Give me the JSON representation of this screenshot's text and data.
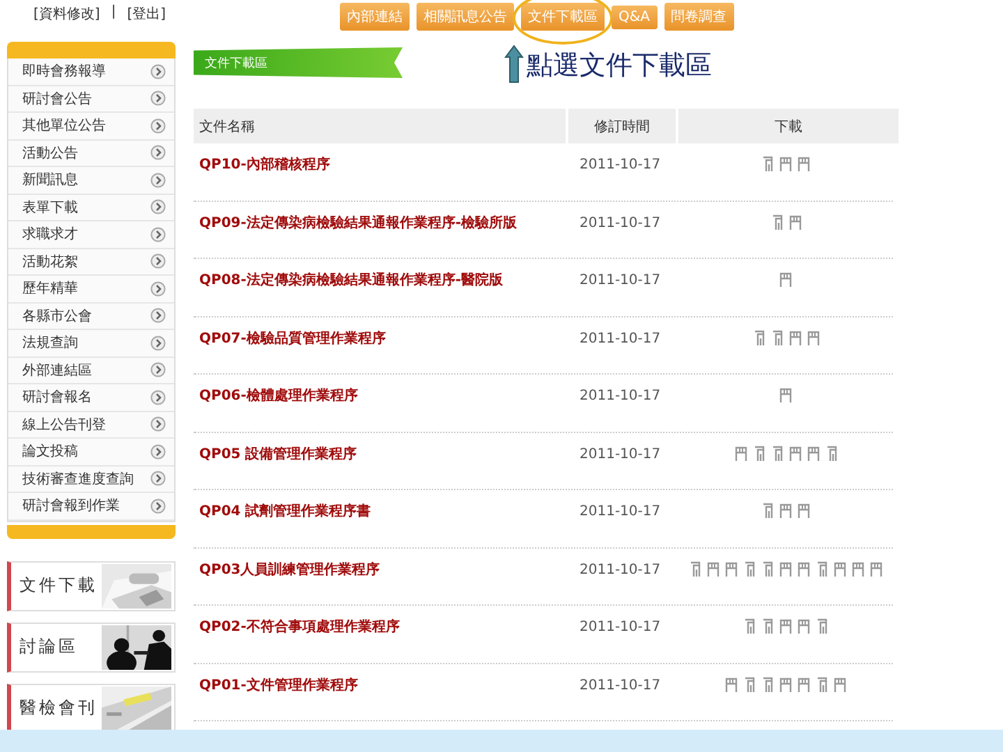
{
  "top_links": [
    "[資料修改]",
    "|",
    "[登出]"
  ],
  "nav": [
    {
      "label": "內部連結",
      "highlighted": false
    },
    {
      "label": "相關訊息公告",
      "highlighted": false
    },
    {
      "label": "文件下載區",
      "highlighted": true
    },
    {
      "label": "Q&A",
      "highlighted": false
    },
    {
      "label": "問卷調查",
      "highlighted": false
    }
  ],
  "annotation": "點選文件下載區",
  "banner": "文件下載區",
  "sidebar": {
    "items": [
      "即時會務報導",
      "研討會公告",
      "其他單位公告",
      "活動公告",
      "新聞訊息",
      "表單下載",
      "求職求才",
      "活動花絮",
      "歷年精華",
      "各縣市公會",
      "法規查詢",
      "外部連結區",
      "研討會報名",
      "線上公告刊登",
      "論文投稿",
      "技術審查進度查詢",
      "研討會報到作業"
    ]
  },
  "cards": [
    {
      "label": "文件下載",
      "kind": "picture"
    },
    {
      "label": "討論區",
      "kind": "picture"
    },
    {
      "label": "醫檢會刊",
      "kind": "picture"
    }
  ],
  "table": {
    "columns": [
      "文件名稱",
      "修訂時間",
      "下載"
    ],
    "rows": [
      {
        "name": "QP10-內部稽核程序",
        "date": "2011-10-17",
        "files": [
          {
            "kind": "doc"
          },
          {
            "kind": "form"
          },
          {
            "kind": "form"
          }
        ]
      },
      {
        "name": "QP09-法定傳染病檢驗結果通報作業程序-檢驗所版",
        "date": "2011-10-17",
        "files": [
          {
            "kind": "doc"
          },
          {
            "kind": "form"
          }
        ]
      },
      {
        "name": "QP08-法定傳染病檢驗結果通報作業程序-醫院版",
        "date": "2011-10-17",
        "files": [
          {
            "kind": "form"
          }
        ]
      },
      {
        "name": "QP07-檢驗品質管理作業程序",
        "date": "2011-10-17",
        "files": [
          {
            "kind": "doc"
          },
          {
            "kind": "doc"
          },
          {
            "kind": "form"
          },
          {
            "kind": "form"
          }
        ]
      },
      {
        "name": "QP06-檢體處理作業程序",
        "date": "2011-10-17",
        "files": [
          {
            "kind": "form"
          }
        ]
      },
      {
        "name": "QP05 設備管理作業程序",
        "date": "2011-10-17",
        "files": [
          {
            "kind": "form"
          },
          {
            "kind": "doc"
          },
          {
            "kind": "doc"
          },
          {
            "kind": "form"
          },
          {
            "kind": "form"
          },
          {
            "kind": "doc"
          }
        ]
      },
      {
        "name": "QP04 試劑管理作業程序書",
        "date": "2011-10-17",
        "files": [
          {
            "kind": "doc"
          },
          {
            "kind": "form"
          },
          {
            "kind": "form"
          }
        ]
      },
      {
        "name": "QP03人員訓練管理作業程序",
        "date": "2011-10-17",
        "files": [
          {
            "kind": "doc"
          },
          {
            "kind": "form"
          },
          {
            "kind": "form"
          },
          {
            "kind": "doc"
          },
          {
            "kind": "doc"
          },
          {
            "kind": "form"
          },
          {
            "kind": "form"
          },
          {
            "kind": "doc"
          },
          {
            "kind": "form"
          },
          {
            "kind": "form"
          },
          {
            "kind": "form"
          }
        ]
      },
      {
        "name": "QP02-不符合事項處理作業程序",
        "date": "2011-10-17",
        "files": [
          {
            "kind": "doc"
          },
          {
            "kind": "doc"
          },
          {
            "kind": "form"
          },
          {
            "kind": "form"
          },
          {
            "kind": "doc"
          }
        ]
      },
      {
        "name": "QP01-文件管理作業程序",
        "date": "2011-10-17",
        "files": [
          {
            "kind": "form"
          },
          {
            "kind": "doc"
          },
          {
            "kind": "doc"
          },
          {
            "kind": "form"
          },
          {
            "kind": "form"
          },
          {
            "kind": "doc"
          },
          {
            "kind": "form"
          }
        ]
      }
    ]
  }
}
